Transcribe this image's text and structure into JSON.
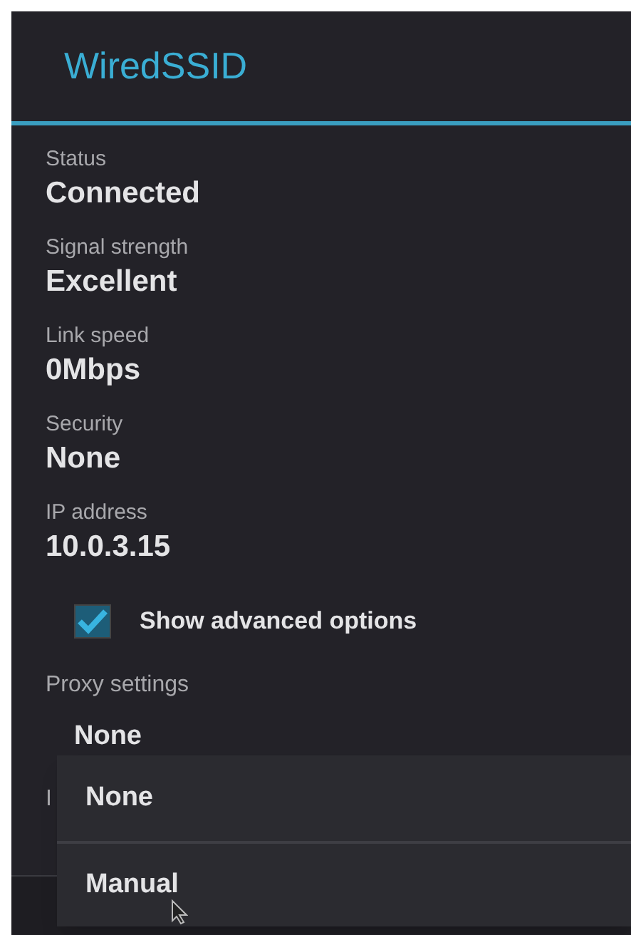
{
  "dialog": {
    "title": "WiredSSID"
  },
  "details": [
    {
      "label": "Status",
      "value": "Connected"
    },
    {
      "label": "Signal strength",
      "value": "Excellent"
    },
    {
      "label": "Link speed",
      "value": "0Mbps"
    },
    {
      "label": "Security",
      "value": "None"
    },
    {
      "label": "IP address",
      "value": "10.0.3.15"
    }
  ],
  "advanced": {
    "label": "Show advanced options",
    "checked": true
  },
  "proxy": {
    "label": "Proxy settings",
    "value": "None"
  },
  "ip_settings_label": "I",
  "dropdown": {
    "options": [
      "None",
      "Manual"
    ]
  }
}
